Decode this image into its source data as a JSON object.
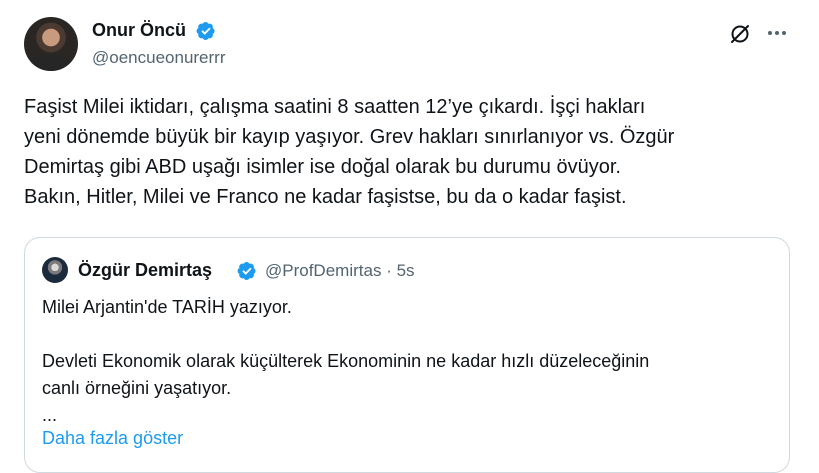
{
  "author": {
    "name": "Onur Öncü",
    "handle": "@oencueonurerrr"
  },
  "icons": {
    "verified": "verified-badge-icon",
    "grok": "grok-icon",
    "more": "more-options-icon",
    "verified_color": "#1d9bf0"
  },
  "tweet": {
    "lines": [
      "Faşist Milei iktidarı, çalışma saatini 8 saatten 12’ye çıkardı. İşçi hakları",
      "yeni dönemde büyük bir kayıp yaşıyor. Grev hakları sınırlanıyor vs. Özgür",
      "Demirtaş gibi ABD uşağı isimler ise doğal olarak bu durumu övüyor.",
      "Bakın, Hitler, Milei ve Franco ne kadar faşistse, bu da o kadar faşist."
    ]
  },
  "quote": {
    "name": "Özgür Demirtaş",
    "handle": "@ProfDemirtas",
    "separator": "·",
    "time": "5s",
    "lines": [
      "Milei Arjantin'de TARİH yazıyor.",
      "Devleti Ekonomik olarak küçülterek Ekonominin ne kadar hızlı düzeleceğinin",
      "canlı örneğini yaşatıyor.",
      "..."
    ],
    "show_more": "Daha fazla göster"
  },
  "colors": {
    "text": "#0f1419",
    "secondary": "#536471",
    "link": "#1d9bf0",
    "border": "#cfd9de"
  }
}
